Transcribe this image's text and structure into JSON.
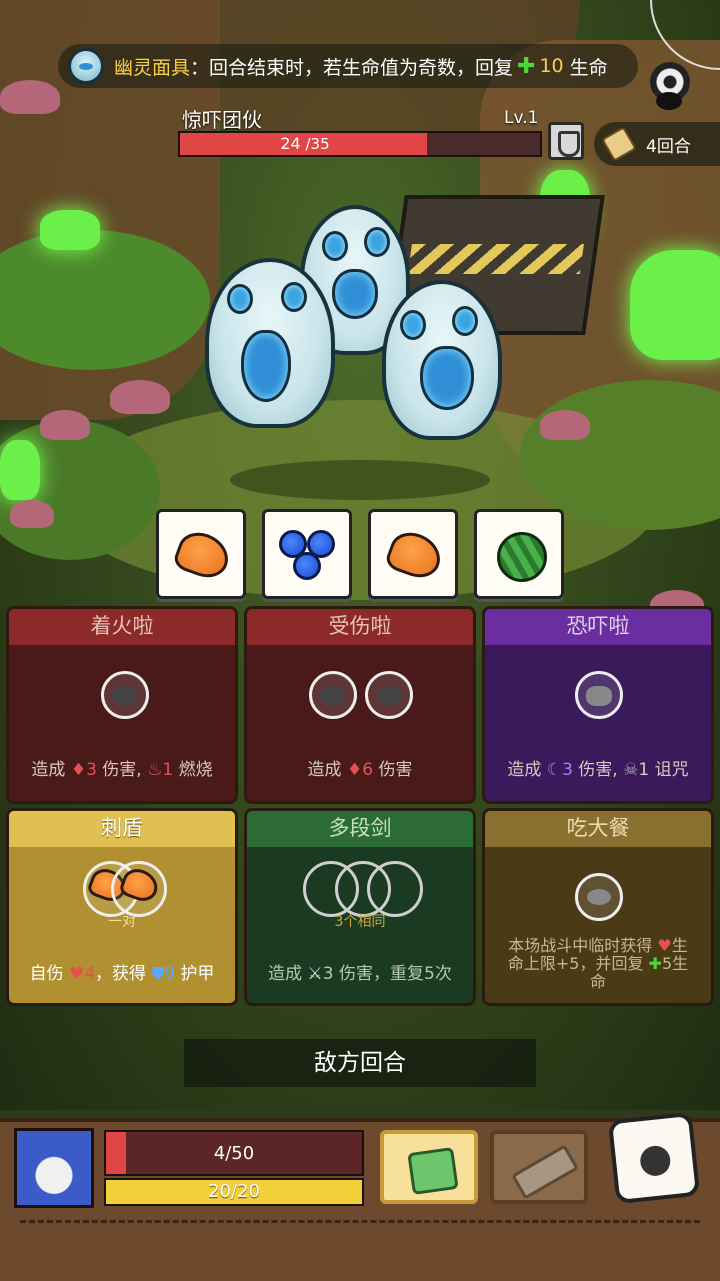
{
  "banner": {
    "item_name": "幽灵面具",
    "effect_text": "：回合结束时，若生命值为奇数，回复",
    "heal_amount": "10",
    "heal_unit": "生命"
  },
  "enemy": {
    "name": "惊吓团伙",
    "level": "Lv.1",
    "hp_current": "24",
    "hp_max": "/35",
    "hp_fraction": 0.686
  },
  "turns": {
    "label": "4回合"
  },
  "dice_row": [
    {
      "face": "pumpkin-icon"
    },
    {
      "face": "blueberry-icon"
    },
    {
      "face": "pumpkin-icon"
    },
    {
      "face": "watermelon-icon"
    }
  ],
  "cards": [
    {
      "title": "着火啦",
      "desc_pre": "造成",
      "v1": "3",
      "mid": "伤害,",
      "v2": "1",
      "post": "燃烧",
      "color": "#7a2222"
    },
    {
      "title": "受伤啦",
      "desc_pre": "造成",
      "v1": "6",
      "mid": "伤害",
      "color": "#7a2222"
    },
    {
      "title": "恐吓啦",
      "desc_pre": "造成",
      "v1": "3",
      "mid": "伤害,",
      "v2": "1",
      "post": "诅咒",
      "color": "#5a2a8a"
    },
    {
      "title": "刺盾",
      "sub": "一对",
      "desc_pre": "自伤",
      "v1": "4",
      "mid": "，获得",
      "v2": "9",
      "post": "护甲",
      "color": "#c9a93a"
    },
    {
      "title": "多段剑",
      "sub": "3个相同",
      "desc_pre": "造成",
      "v1": "3",
      "mid": "伤害，重复5次",
      "color": "#1f4a2a"
    },
    {
      "title": "吃大餐",
      "line1": "本场战斗中临时获得",
      "line2a": "生",
      "line2b": "命上限+5，并回复",
      "line2c": "5生",
      "line3": "命",
      "color": "#7a6224"
    }
  ],
  "end_turn": {
    "label": "敌方回合"
  },
  "player": {
    "hp_text": "4/50",
    "hp_fraction": 0.08,
    "energy_text": "20/20"
  },
  "colors": {
    "enemy_hp": "#e04646",
    "energy": "#f3cf3a",
    "accent_gold": "#f5d04a"
  }
}
